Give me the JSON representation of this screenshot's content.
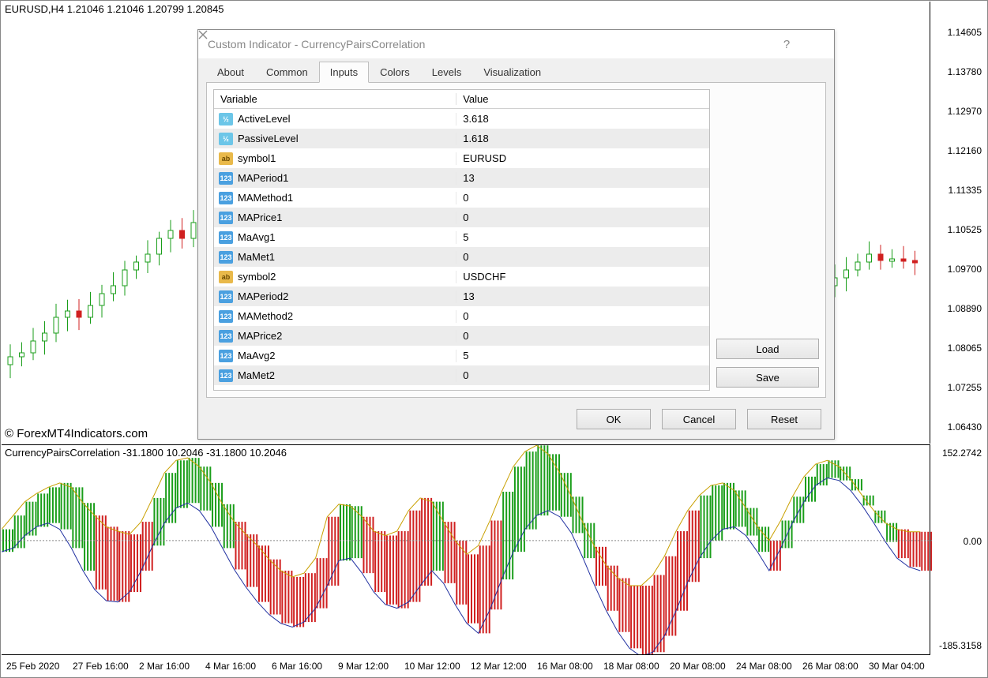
{
  "chart": {
    "label": "EURUSD,H4  1.21046 1.21046 1.20799 1.20845",
    "watermark": "© ForexMT4Indicators.com",
    "price_ticks": [
      "1.14605",
      "1.13780",
      "1.12970",
      "1.12160",
      "1.11335",
      "1.10525",
      "1.09700",
      "1.08890",
      "1.08065",
      "1.07255",
      "1.06430"
    ]
  },
  "indicator": {
    "label": "CurrencyPairsCorrelation -31.1800 10.2046 -31.1800 10.2046",
    "ticks": [
      "152.2742",
      "0.00",
      "-185.3158"
    ]
  },
  "time_ticks": [
    "25 Feb 2020",
    "27 Feb 16:00",
    "2 Mar 16:00",
    "4 Mar 16:00",
    "6 Mar 16:00",
    "9 Mar 12:00",
    "10 Mar 12:00",
    "12 Mar 12:00",
    "16 Mar 08:00",
    "18 Mar 08:00",
    "20 Mar 08:00",
    "24 Mar 08:00",
    "26 Mar 08:00",
    "30 Mar 04:00"
  ],
  "dialog": {
    "title": "Custom Indicator - CurrencyPairsCorrelation",
    "tabs": [
      "About",
      "Common",
      "Inputs",
      "Colors",
      "Levels",
      "Visualization"
    ],
    "active_tab": "Inputs",
    "col_var": "Variable",
    "col_val": "Value",
    "rows": [
      {
        "icon": "dbl",
        "name": "ActiveLevel",
        "value": "3.618"
      },
      {
        "icon": "dbl",
        "name": "PassiveLevel",
        "value": "1.618"
      },
      {
        "icon": "str",
        "name": "symbol1",
        "value": "EURUSD"
      },
      {
        "icon": "num",
        "name": "MAPeriod1",
        "value": "13"
      },
      {
        "icon": "num",
        "name": "MAMethod1",
        "value": "0"
      },
      {
        "icon": "num",
        "name": "MAPrice1",
        "value": "0"
      },
      {
        "icon": "num",
        "name": "MaAvg1",
        "value": "5"
      },
      {
        "icon": "num",
        "name": "MaMet1",
        "value": "0"
      },
      {
        "icon": "str",
        "name": "symbol2",
        "value": "USDCHF"
      },
      {
        "icon": "num",
        "name": "MAPeriod2",
        "value": "13"
      },
      {
        "icon": "num",
        "name": "MAMethod2",
        "value": "0"
      },
      {
        "icon": "num",
        "name": "MAPrice2",
        "value": "0"
      },
      {
        "icon": "num",
        "name": "MaAvg2",
        "value": "5"
      },
      {
        "icon": "num",
        "name": "MaMet2",
        "value": "0"
      }
    ],
    "buttons": {
      "load": "Load",
      "save": "Save",
      "ok": "OK",
      "cancel": "Cancel",
      "reset": "Reset"
    }
  },
  "chart_data": [
    {
      "type": "candlestick",
      "title": "EURUSD,H4",
      "ylim": [
        1.0643,
        1.14605
      ],
      "series_note": "approximate OHLC path of EURUSD H4 over 25 Feb – 30 Mar 2020; rises from ~1.083 to ~1.146 then falls to ~1.066 then recovers to ~1.108"
    },
    {
      "type": "area",
      "title": "CurrencyPairsCorrelation",
      "ylim": [
        -185.3158,
        152.2742
      ],
      "x": [
        0,
        1,
        2,
        3,
        4,
        5,
        6,
        7,
        8,
        9,
        10,
        11,
        12,
        13,
        14,
        15,
        16,
        17,
        18,
        19,
        20,
        21,
        22,
        23,
        24,
        25,
        26,
        27,
        28,
        29,
        30,
        31,
        32,
        33,
        34,
        35,
        36,
        37,
        38,
        39,
        40,
        41,
        42,
        43,
        44,
        45,
        46,
        47,
        48,
        49,
        50,
        51,
        52,
        53,
        54,
        55,
        56,
        57,
        58,
        59,
        60,
        61,
        62,
        63,
        64,
        65,
        66,
        67,
        68,
        69,
        70,
        71,
        72,
        73,
        74,
        75,
        76,
        77,
        78,
        79
      ],
      "upper": [
        18,
        40,
        62,
        75,
        85,
        92,
        85,
        60,
        40,
        22,
        15,
        10,
        30,
        68,
        108,
        128,
        132,
        118,
        92,
        58,
        30,
        10,
        -8,
        -30,
        -48,
        -58,
        -52,
        -28,
        38,
        58,
        55,
        38,
        15,
        8,
        15,
        48,
        68,
        62,
        30,
        0,
        -22,
        -8,
        32,
        78,
        118,
        142,
        152,
        138,
        108,
        70,
        28,
        -10,
        -40,
        -60,
        -72,
        -72,
        -55,
        -25,
        15,
        48,
        72,
        88,
        92,
        80,
        52,
        22,
        0,
        32,
        70,
        102,
        122,
        128,
        118,
        98,
        72,
        48,
        28,
        18,
        14,
        14
      ],
      "lower": [
        -18,
        -12,
        8,
        22,
        28,
        18,
        -12,
        -48,
        -78,
        -96,
        -98,
        -82,
        -48,
        -8,
        28,
        52,
        60,
        48,
        22,
        -12,
        -46,
        -74,
        -98,
        -118,
        -132,
        -138,
        -130,
        -108,
        -72,
        -32,
        -28,
        -52,
        -82,
        -102,
        -108,
        -98,
        -72,
        -48,
        -68,
        -102,
        -132,
        -148,
        -110,
        -62,
        -18,
        18,
        40,
        48,
        38,
        12,
        -28,
        -72,
        -112,
        -146,
        -172,
        -185,
        -178,
        -152,
        -112,
        -66,
        -28,
        0,
        18,
        22,
        8,
        -18,
        -48,
        -12,
        28,
        62,
        88,
        100,
        96,
        80,
        56,
        28,
        -2,
        -28,
        -42,
        -48
      ],
      "color_rule": "green when upper>0 and lower> -20 envelope above zero; red when envelope predominantly below zero"
    }
  ]
}
